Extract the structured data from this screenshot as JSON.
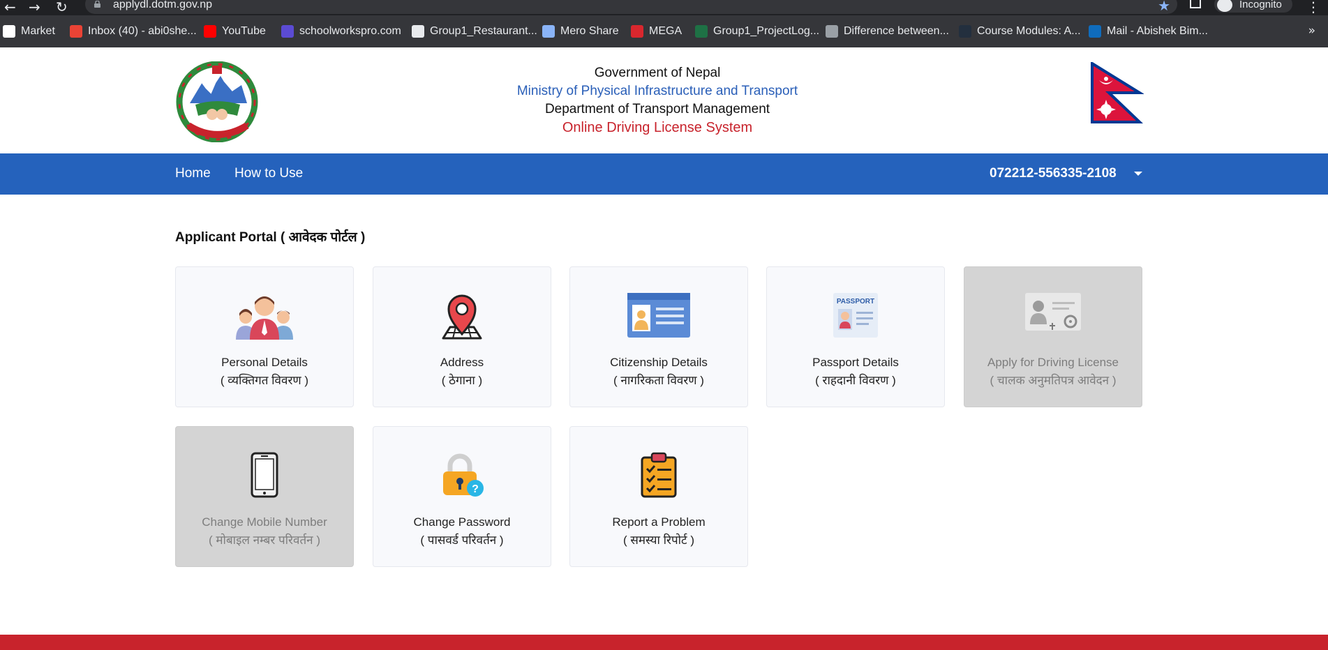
{
  "browser": {
    "url": "applydl.dotm.gov.np",
    "incognito_label": "Incognito",
    "more_bookmarks": "»",
    "bookmarks": [
      {
        "label": "Market",
        "color": "#ffffff"
      },
      {
        "label": "Inbox (40) - abi0she...",
        "color": "#ea4335"
      },
      {
        "label": "YouTube",
        "color": "#ff0000"
      },
      {
        "label": "schoolworkspro.com",
        "color": "#5b4bd4"
      },
      {
        "label": "Group1_Restaurant...",
        "color": "#e8eaed"
      },
      {
        "label": "Mero Share",
        "color": "#8ab4f8"
      },
      {
        "label": "MEGA",
        "color": "#d9272e"
      },
      {
        "label": "Group1_ProjectLog...",
        "color": "#1e7145"
      },
      {
        "label": "Difference between...",
        "color": "#9aa0a6"
      },
      {
        "label": "Course Modules: A...",
        "color": "#232f3e"
      },
      {
        "label": "Mail - Abishek Bim...",
        "color": "#0f6cbd"
      }
    ]
  },
  "header": {
    "line1": "Government of Nepal",
    "line2": "Ministry of Physical Infrastructure and Transport",
    "line3": "Department of Transport Management",
    "line4": "Online Driving License System"
  },
  "nav": {
    "home": "Home",
    "how_to_use": "How to Use",
    "user_id": "072212-556335-2108"
  },
  "portal": {
    "title": "Applicant Portal ( आवेदक पोर्टल )",
    "cards": [
      {
        "icon": "family-icon",
        "label_en": "Personal Details",
        "label_np": "( व्यक्तिगत विवरण )",
        "enabled": true
      },
      {
        "icon": "location-pin-icon",
        "label_en": "Address",
        "label_np": "( ठेगाना )",
        "enabled": true
      },
      {
        "icon": "id-card-icon",
        "label_en": "Citizenship Details",
        "label_np": "( नागरिकता विवरण )",
        "enabled": true
      },
      {
        "icon": "passport-icon",
        "label_en": "Passport Details",
        "label_np": "( राहदानी विवरण )",
        "enabled": true
      },
      {
        "icon": "driving-license-icon",
        "label_en": "Apply for Driving License",
        "label_np": "( चालक अनुमतिपत्र आवेदन )",
        "enabled": false
      },
      {
        "icon": "mobile-phone-icon",
        "label_en": "Change Mobile Number",
        "label_np": "( मोबाइल नम्बर परिवर्तन )",
        "enabled": false
      },
      {
        "icon": "padlock-question-icon",
        "label_en": "Change Password",
        "label_np": "( पासवर्ड परिवर्तन )",
        "enabled": true
      },
      {
        "icon": "clipboard-checklist-icon",
        "label_en": "Report a Problem",
        "label_np": "( समस्या रिपोर्ट )",
        "enabled": true
      }
    ]
  },
  "colors": {
    "navbar": "#2562bc",
    "accent_red": "#c8232c",
    "ministry_blue": "#2a5fb8",
    "card_bg": "#f8f9fc",
    "card_disabled": "#d4d4d4"
  }
}
